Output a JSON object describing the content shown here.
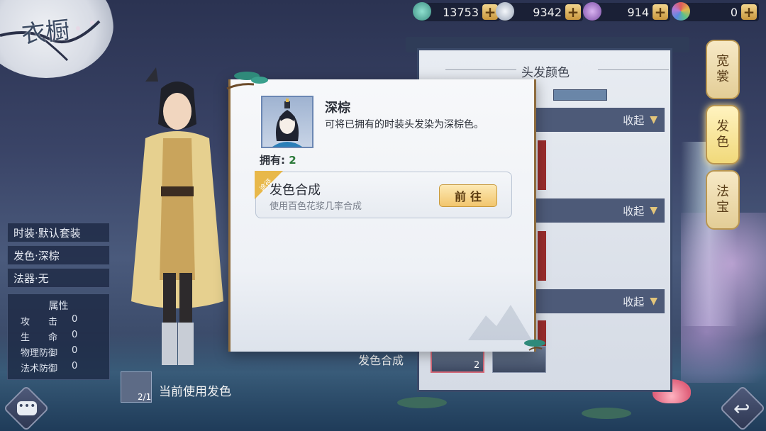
{
  "logo_text": "衣橱",
  "currencies": [
    {
      "icon": "jade-gem-icon",
      "value": "13753",
      "color": "#5fb8a8"
    },
    {
      "icon": "silver-ingot-icon",
      "value": "9342",
      "color": "#c9d2de"
    },
    {
      "icon": "lock-gem-icon",
      "value": "914",
      "color": "#b07ad8"
    },
    {
      "icon": "rainbow-gem-icon",
      "value": "0",
      "color": "#e0b84c"
    }
  ],
  "plus_label": "+",
  "left_tags": {
    "outfit": "时装·默认套装",
    "hair_color": "发色·深棕",
    "artifact": "法器·无"
  },
  "attributes": {
    "header": "属性",
    "rows": [
      {
        "name": "攻　　击",
        "value": "0"
      },
      {
        "name": "生　　命",
        "value": "0"
      },
      {
        "name": "物理防御",
        "value": "0"
      },
      {
        "name": "法术防御",
        "value": "0"
      }
    ]
  },
  "current_hair": {
    "label": "当前使用发色",
    "count": "2/1"
  },
  "chat_dots": "•••",
  "right_panel": {
    "title": "头发颜色",
    "collapse_label": "收起",
    "thumb_count": "2",
    "synth_under": "发色合成"
  },
  "right_tabs": [
    {
      "label": "宽\n裳",
      "active": false
    },
    {
      "label": "发\n色",
      "active": true
    },
    {
      "label": "法\n宝",
      "active": false
    }
  ],
  "popup": {
    "item_name": "深棕",
    "item_desc": "可将已拥有的时装头发染为深棕色。",
    "owned_label": "拥有: ",
    "owned_count": "2",
    "source": {
      "badge": "途径",
      "title": "发色合成",
      "subtitle": "使用百色花浆几率合成",
      "button": "前往"
    }
  },
  "colors": {
    "accent_gold": "#f2c66e",
    "panel_navy": "#4d5a78",
    "owned_green": "#2c7a3a"
  }
}
